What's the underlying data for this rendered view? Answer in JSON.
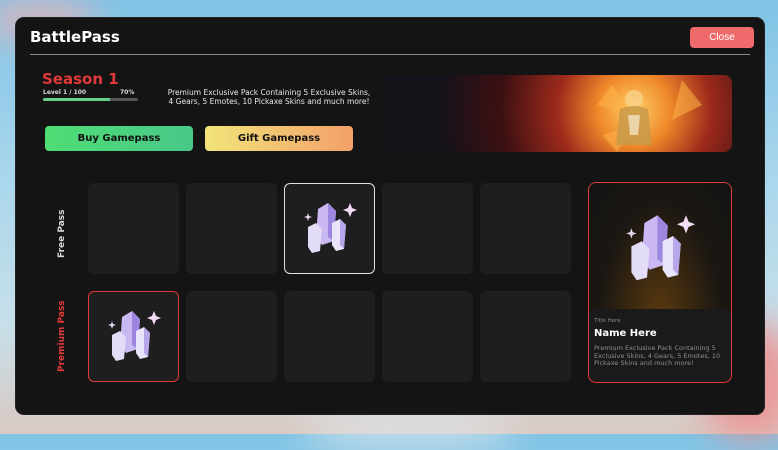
{
  "window": {
    "title": "BattlePass",
    "close_label": "Close"
  },
  "season": {
    "name": "Season 1",
    "level_text": "Level 1 / 100",
    "progress_text": "70%",
    "progress_fraction": 0.7
  },
  "pack": {
    "description": "Premium Exclusive Pack Containing 5 Exclusive Skins, 4 Gears, 5 Emotes, 10 Pickaxe Skins and much more!"
  },
  "actions": {
    "buy_label": "Buy Gamepass",
    "gift_label": "Gift Gamepass"
  },
  "tracks": {
    "free_label": "Free Pass",
    "premium_label": "Premium Pass",
    "free_slots": [
      {
        "icon": ""
      },
      {
        "icon": ""
      },
      {
        "icon": "crystal-icon",
        "selected": true
      },
      {
        "icon": ""
      },
      {
        "icon": ""
      }
    ],
    "premium_slots": [
      {
        "icon": "crystal-icon",
        "highlighted": true
      },
      {
        "icon": ""
      },
      {
        "icon": ""
      },
      {
        "icon": ""
      },
      {
        "icon": ""
      }
    ]
  },
  "detail": {
    "title_label": "Title Here",
    "name": "Name Here",
    "description": "Premium Exclusive Pack Containing 5 Exclusive Skins, 4 Gears, 5 Emotes, 10 Pickaxe Skins and much more!"
  },
  "colors": {
    "accent_red": "#e23a3a",
    "close_bg": "#ef6b6b",
    "buy_bg": "#4fdd74",
    "gift_bg": "#f2e57a",
    "progress": "#66d08a"
  }
}
